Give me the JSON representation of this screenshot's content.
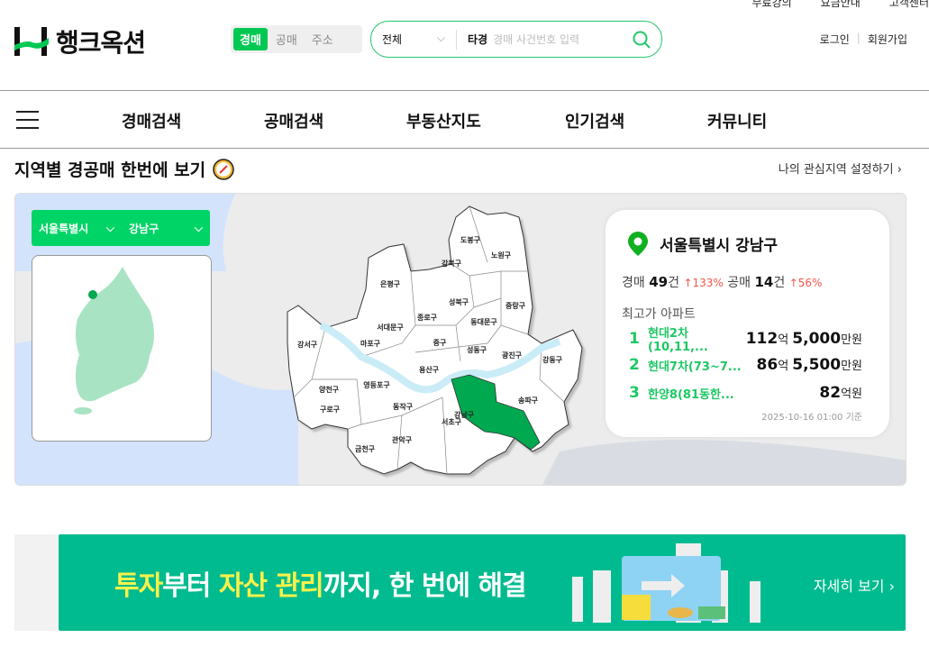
{
  "top_links": [
    "무료강의",
    "요금안내",
    "고객센터"
  ],
  "logo": {
    "text": "행크옥션"
  },
  "search_type_tabs": [
    {
      "label": "경매",
      "active": true
    },
    {
      "label": "공매",
      "active": false
    },
    {
      "label": "주소",
      "active": false
    }
  ],
  "search": {
    "scope": "전체",
    "prefix": "타경",
    "placeholder": "경매 사건번호 입력"
  },
  "auth": {
    "login": "로그인",
    "signup": "회원가입"
  },
  "nav": [
    "경매검색",
    "공매검색",
    "부동산지도",
    "인기검색",
    "커뮤니티"
  ],
  "section": {
    "title": "지역별 경공매 한번에 보기",
    "link": "나의 관심지역 설정하기"
  },
  "selectors": {
    "city": "서울특별시",
    "district": "강남구"
  },
  "districts": [
    "도봉구",
    "노원구",
    "강북구",
    "은평구",
    "성북구",
    "중랑구",
    "종로구",
    "동대문구",
    "서대문구",
    "강서구",
    "마포구",
    "중구",
    "성동구",
    "광진구",
    "강동구",
    "용산구",
    "양천구",
    "영등포구",
    "송파구",
    "구로구",
    "동작구",
    "강남구",
    "서초구",
    "관악구",
    "금천구"
  ],
  "card": {
    "title": "서울특별시 강남구",
    "auction_label": "경매",
    "auction_count": "49",
    "auction_unit": "건",
    "auction_change": "↑133%",
    "public_label": "공매",
    "public_count": "14",
    "public_unit": "건",
    "public_change": "↑56%",
    "top_title": "최고가 아파트",
    "top": [
      {
        "rank": "1",
        "name": "현대2차(10,11,...",
        "eok": "112",
        "eok_unit": "억",
        "man": "5,000",
        "man_unit": "만원"
      },
      {
        "rank": "2",
        "name": "현대7차(73~7...",
        "eok": "86",
        "eok_unit": "억",
        "man": "5,500",
        "man_unit": "만원"
      },
      {
        "rank": "3",
        "name": "한양8(81동한...",
        "eok": "82",
        "eok_unit": "억원",
        "man": "",
        "man_unit": ""
      }
    ],
    "date": "2025-10-16 01:00 기준"
  },
  "banner": {
    "t1": "투자",
    "t2": "부터 ",
    "t3": "자산 관리",
    "t4": "까지, 한 번에 해결",
    "more": "자세히 보기 ›"
  },
  "colors": {
    "brand": "#00c853",
    "selected_district": "#00a84f",
    "banner": "#00bb8f"
  }
}
